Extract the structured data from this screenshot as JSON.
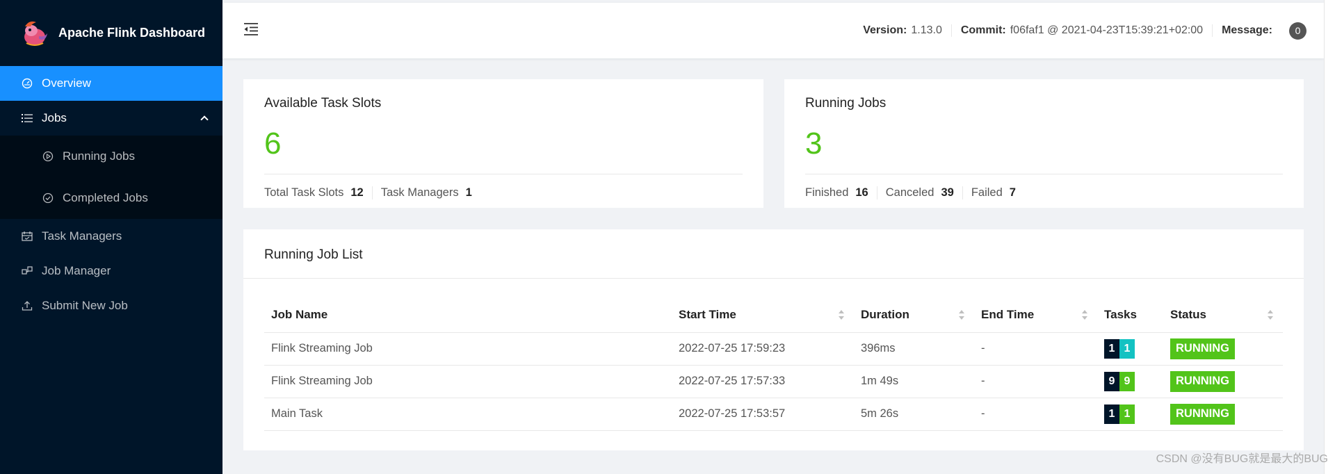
{
  "app": {
    "title": "Apache Flink Dashboard"
  },
  "sidebar": {
    "items": [
      {
        "label": "Overview",
        "icon": "dashboard-icon",
        "selected": true
      },
      {
        "label": "Jobs",
        "icon": "list-icon",
        "expanded": true
      },
      {
        "label": "Running Jobs",
        "icon": "play-circle-icon"
      },
      {
        "label": "Completed Jobs",
        "icon": "check-circle-icon"
      },
      {
        "label": "Task Managers",
        "icon": "schedule-icon"
      },
      {
        "label": "Job Manager",
        "icon": "cluster-icon"
      },
      {
        "label": "Submit New Job",
        "icon": "upload-icon"
      }
    ]
  },
  "header": {
    "version_label": "Version:",
    "version_value": "1.13.0",
    "commit_label": "Commit:",
    "commit_value": "f06faf1 @ 2021-04-23T15:39:21+02:00",
    "message_label": "Message:",
    "message_count": "0"
  },
  "slots_card": {
    "title": "Available Task Slots",
    "value": "6",
    "total_label": "Total Task Slots",
    "total_value": "12",
    "tm_label": "Task Managers",
    "tm_value": "1"
  },
  "jobs_card": {
    "title": "Running Jobs",
    "value": "3",
    "finished_label": "Finished",
    "finished_value": "16",
    "canceled_label": "Canceled",
    "canceled_value": "39",
    "failed_label": "Failed",
    "failed_value": "7"
  },
  "job_list": {
    "title": "Running Job List",
    "columns": [
      "Job Name",
      "Start Time",
      "Duration",
      "End Time",
      "Tasks",
      "Status"
    ],
    "rows": [
      {
        "name": "Flink Streaming Job",
        "start": "2022-07-25 17:59:23",
        "duration": "396ms",
        "end": "-",
        "tasks_total": "1",
        "tasks_running": "1",
        "tasks_color": "#13c2c2",
        "status": "RUNNING"
      },
      {
        "name": "Flink Streaming Job",
        "start": "2022-07-25 17:57:33",
        "duration": "1m 49s",
        "end": "-",
        "tasks_total": "9",
        "tasks_running": "9",
        "tasks_color": "#52c41a",
        "status": "RUNNING"
      },
      {
        "name": "Main Task",
        "start": "2022-07-25 17:53:57",
        "duration": "5m 26s",
        "end": "-",
        "tasks_total": "1",
        "tasks_running": "1",
        "tasks_color": "#52c41a",
        "status": "RUNNING"
      }
    ]
  },
  "colors": {
    "accent": "#1890ff",
    "success": "#52c41a",
    "sidebar": "#001529",
    "task_total": "#001529"
  },
  "watermark": "CSDN @没有BUG就是最大的BUG"
}
